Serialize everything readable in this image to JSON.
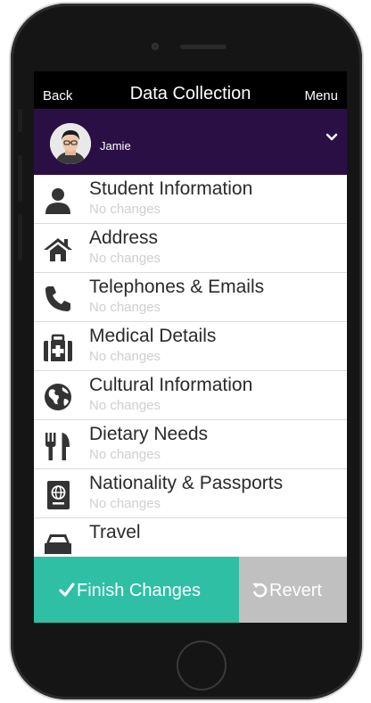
{
  "header": {
    "back_label": "Back",
    "title": "Data Collection",
    "menu_label": "Menu"
  },
  "user": {
    "name": "Jamie"
  },
  "list": {
    "items": [
      {
        "label": "Student Information",
        "status": "No changes",
        "icon": "user-icon"
      },
      {
        "label": "Address",
        "status": "No changes",
        "icon": "home-icon"
      },
      {
        "label": "Telephones & Emails",
        "status": "No changes",
        "icon": "phone-icon"
      },
      {
        "label": "Medical Details",
        "status": "No changes",
        "icon": "medical-kit-icon"
      },
      {
        "label": "Cultural Information",
        "status": "No changes",
        "icon": "globe-icon"
      },
      {
        "label": "Dietary Needs",
        "status": "No changes",
        "icon": "cutlery-icon"
      },
      {
        "label": "Nationality & Passports",
        "status": "No changes",
        "icon": "passport-icon"
      },
      {
        "label": "Travel",
        "status": "",
        "icon": "car-icon"
      }
    ]
  },
  "footer": {
    "finish_label": "Finish Changes",
    "revert_label": "Revert"
  },
  "colors": {
    "user_bar": "#2a0f45",
    "finish": "#2ebfa5",
    "revert": "#c0c0c0"
  }
}
